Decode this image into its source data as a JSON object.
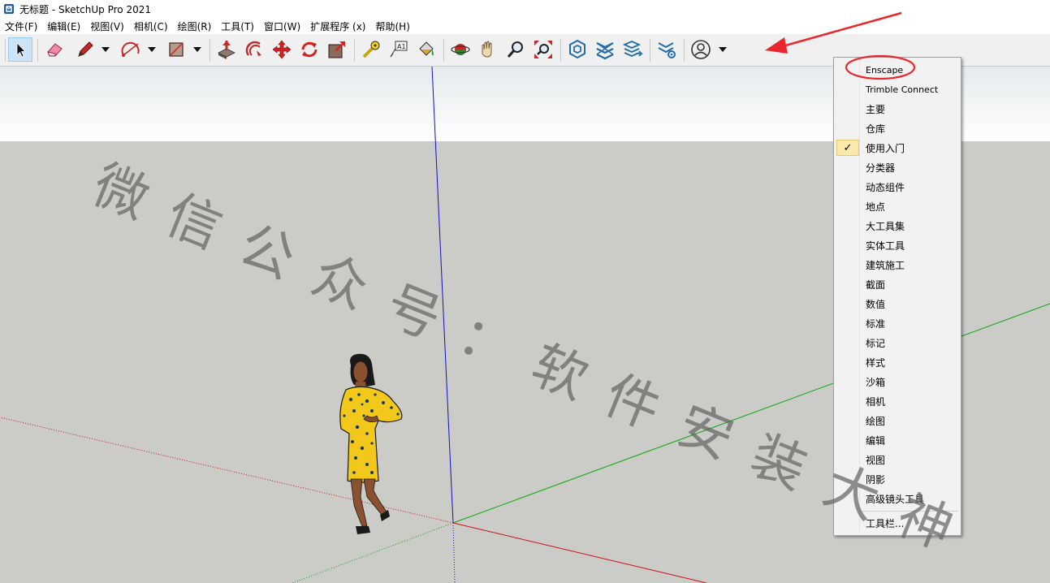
{
  "window": {
    "title": "无标题 - SketchUp Pro 2021"
  },
  "menubar": {
    "items": [
      "文件(F)",
      "编辑(E)",
      "视图(V)",
      "相机(C)",
      "绘图(R)",
      "工具(T)",
      "窗口(W)",
      "扩展程序 (x)",
      "帮助(H)"
    ]
  },
  "toolbar": {
    "tools": [
      {
        "name": "select-icon",
        "active": true
      },
      {
        "name": "eraser-icon"
      },
      {
        "name": "pencil-icon",
        "dropdown": true
      },
      {
        "name": "arc-icon",
        "dropdown": true
      },
      {
        "name": "rectangle-icon",
        "dropdown": true
      },
      {
        "name": "push-pull-icon"
      },
      {
        "name": "offset-icon"
      },
      {
        "name": "move-icon"
      },
      {
        "name": "rotate-icon"
      },
      {
        "name": "scale-icon"
      },
      {
        "name": "tape-measure-icon"
      },
      {
        "name": "text-icon"
      },
      {
        "name": "paint-bucket-icon"
      },
      {
        "name": "orbit-icon"
      },
      {
        "name": "pan-icon"
      },
      {
        "name": "zoom-icon"
      },
      {
        "name": "zoom-extents-icon"
      },
      {
        "name": "trimble-connect-icon"
      },
      {
        "name": "warehouse-icon"
      },
      {
        "name": "extension-warehouse-icon"
      },
      {
        "name": "extension-manager-icon"
      },
      {
        "name": "account-icon",
        "dropdown": true
      }
    ]
  },
  "context_menu": {
    "items": [
      {
        "label": "Enscape",
        "highlighted": true
      },
      {
        "label": "Trimble Connect"
      },
      {
        "label": "主要"
      },
      {
        "label": "仓库"
      },
      {
        "label": "使用入门",
        "checked": true
      },
      {
        "label": "分类器"
      },
      {
        "label": "动态组件"
      },
      {
        "label": "地点"
      },
      {
        "label": "大工具集"
      },
      {
        "label": "实体工具"
      },
      {
        "label": "建筑施工"
      },
      {
        "label": "截面"
      },
      {
        "label": "数值"
      },
      {
        "label": "标准"
      },
      {
        "label": "标记"
      },
      {
        "label": "样式"
      },
      {
        "label": "沙箱"
      },
      {
        "label": "相机"
      },
      {
        "label": "绘图"
      },
      {
        "label": "编辑"
      },
      {
        "label": "视图"
      },
      {
        "label": "阴影"
      },
      {
        "label": "高级镜头工具"
      }
    ],
    "footer_item": "工具栏..."
  },
  "watermark": {
    "chars": [
      "微",
      "信",
      "公",
      "众",
      "号",
      "：",
      "软",
      "件",
      "安",
      "装",
      "大",
      "神"
    ]
  },
  "colors": {
    "sky_top": "#e6eaec",
    "ground": "#cbcbc8",
    "axis_red": "#d01010",
    "axis_green": "#0ea80e",
    "axis_blue": "#1010c8",
    "annotation_red": "#e8282c",
    "menu_check_bg": "#fce8a8"
  }
}
